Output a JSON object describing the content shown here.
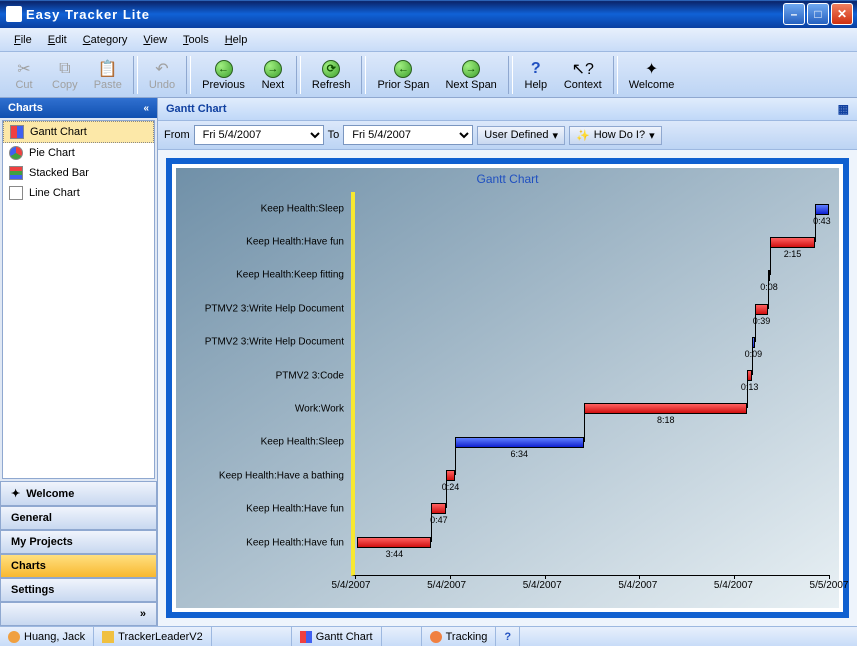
{
  "window": {
    "title": "Easy Tracker Lite"
  },
  "menu": {
    "file": "File",
    "edit": "Edit",
    "category": "Category",
    "view": "View",
    "tools": "Tools",
    "help": "Help"
  },
  "toolbar": {
    "cut": "Cut",
    "copy": "Copy",
    "paste": "Paste",
    "undo": "Undo",
    "previous": "Previous",
    "next": "Next",
    "refresh": "Refresh",
    "priorspan": "Prior Span",
    "nextspan": "Next Span",
    "help": "Help",
    "context": "Context",
    "welcome": "Welcome"
  },
  "sidebar": {
    "header": "Charts",
    "items": [
      {
        "label": "Gantt Chart"
      },
      {
        "label": "Pie Chart"
      },
      {
        "label": "Stacked Bar"
      },
      {
        "label": "Line Chart"
      }
    ],
    "nav": {
      "welcome": "Welcome",
      "general": "General",
      "myprojects": "My Projects",
      "charts": "Charts",
      "settings": "Settings"
    }
  },
  "content": {
    "title": "Gantt Chart",
    "from_lbl": "From",
    "to_lbl": "To",
    "from_val": "Fri 5/4/2007",
    "to_val": "Fri 5/4/2007",
    "userdef": "User Defined",
    "howdo": "How Do I?"
  },
  "chart_data": {
    "type": "gantt",
    "title": "Gantt Chart",
    "xlabel": "",
    "ylabel": "",
    "x_ticks": [
      "5/4/2007",
      "5/4/2007",
      "5/4/2007",
      "5/4/2007",
      "5/4/2007",
      "5/5/2007"
    ],
    "tasks": [
      {
        "label": "Keep Health:Sleep",
        "start": 0.97,
        "end": 1.0,
        "color": "blue",
        "duration": "0:43"
      },
      {
        "label": "Keep Health:Have fun",
        "start": 0.876,
        "end": 0.97,
        "color": "red",
        "duration": "2:15"
      },
      {
        "label": "Keep Health:Keep fitting",
        "start": 0.871,
        "end": 0.876,
        "color": "blue",
        "duration": "0:08"
      },
      {
        "label": "PTMV2 3:Write Help Document",
        "start": 0.844,
        "end": 0.871,
        "color": "red",
        "duration": "0:39"
      },
      {
        "label": "PTMV2 3:Write Help Document",
        "start": 0.837,
        "end": 0.844,
        "color": "blue",
        "duration": "0:09"
      },
      {
        "label": "PTMV2 3:Code",
        "start": 0.828,
        "end": 0.837,
        "color": "red",
        "duration": "0:13"
      },
      {
        "label": "Work:Work",
        "start": 0.483,
        "end": 0.828,
        "color": "red",
        "duration": "8:18"
      },
      {
        "label": "Keep Health:Sleep",
        "start": 0.21,
        "end": 0.483,
        "color": "blue",
        "duration": "6:34"
      },
      {
        "label": "Keep Health:Have a bathing",
        "start": 0.193,
        "end": 0.21,
        "color": "red",
        "duration": "0:24"
      },
      {
        "label": "Keep Health:Have fun",
        "start": 0.161,
        "end": 0.193,
        "color": "red",
        "duration": "0:47"
      },
      {
        "label": "Keep Health:Have fun",
        "start": 0.005,
        "end": 0.161,
        "color": "red",
        "duration": "3:44"
      }
    ]
  },
  "statusbar": {
    "user": "Huang, Jack",
    "proj": "TrackerLeaderV2",
    "view": "Gantt Chart",
    "track": "Tracking"
  }
}
